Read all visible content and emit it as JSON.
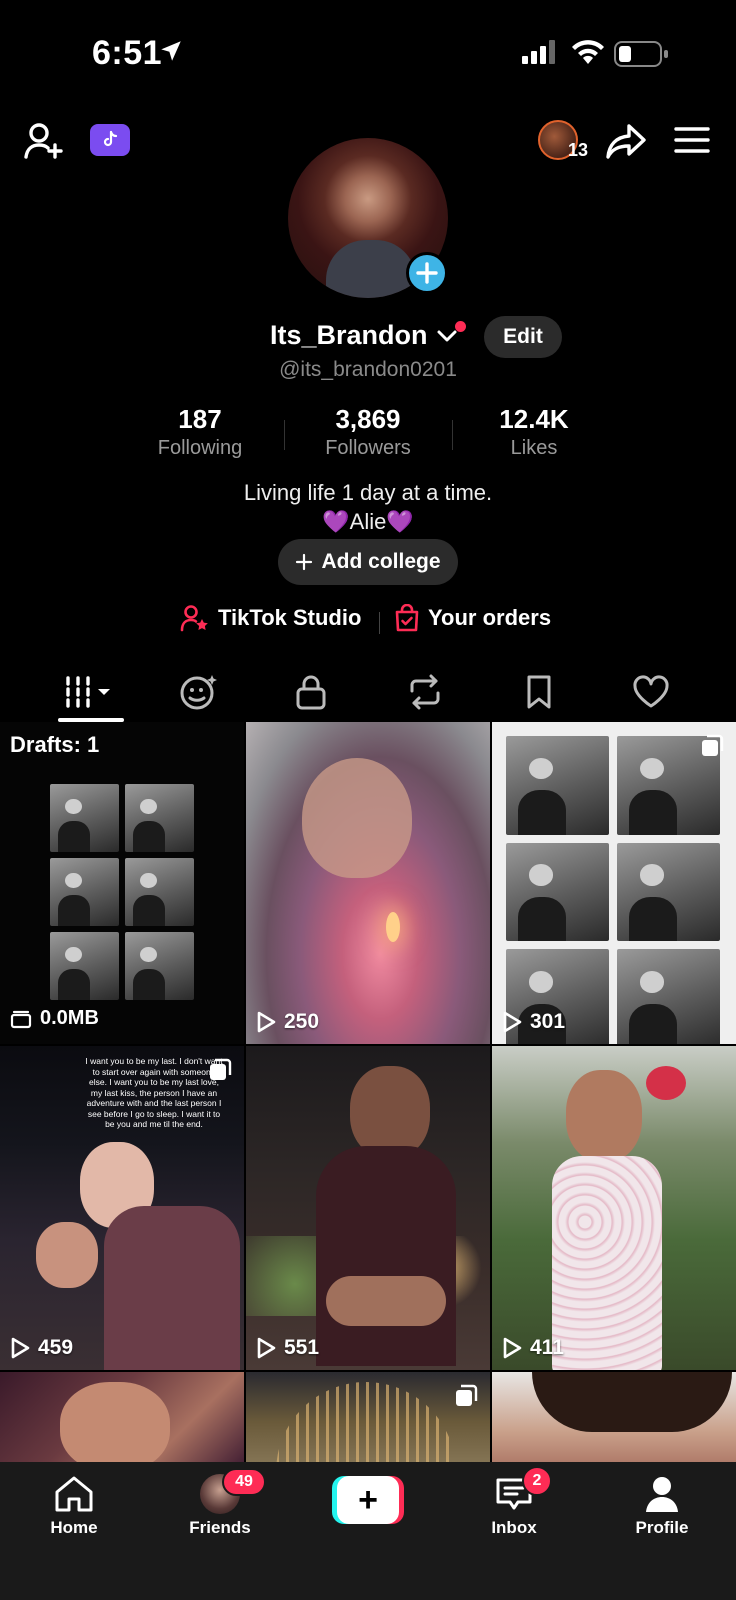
{
  "status_bar": {
    "time": "6:51"
  },
  "top_bar": {
    "story_count": "13"
  },
  "profile": {
    "username": "Its_Brandon",
    "handle": "@its_brandon0201",
    "edit_label": "Edit",
    "stats": [
      {
        "value": "187",
        "label": "Following"
      },
      {
        "value": "3,869",
        "label": "Followers"
      },
      {
        "value": "12.4K",
        "label": "Likes"
      }
    ],
    "bio_line1": "Living life 1 day at a time.",
    "bio_line2": "💜Alie💜",
    "add_college_label": "Add college"
  },
  "links": {
    "studio": "TikTok Studio",
    "orders": "Your orders"
  },
  "tabs": [
    "videos",
    "reposts-emoji",
    "private",
    "repost",
    "favorites",
    "liked"
  ],
  "grid": {
    "drafts_label": "Drafts: 1",
    "drafts_size": "0.0MB",
    "videos": [
      {
        "views": "250"
      },
      {
        "views": "301"
      },
      {
        "views": "459"
      },
      {
        "views": "551"
      },
      {
        "views": "411"
      }
    ],
    "overlay_text": "I want you to be my last. I don't want to start over again with someone else. I want you to be my last love, my last kiss, the person I have an adventure with and the last person I see before I go to sleep. I want it to be you and me til the end."
  },
  "bottom_nav": {
    "home": "Home",
    "friends": "Friends",
    "friends_badge": "49",
    "inbox": "Inbox",
    "inbox_badge": "2",
    "profile": "Profile"
  },
  "colors": {
    "accent_red": "#fe2c55",
    "accent_cyan": "#25f4ee",
    "add_blue": "#3eb4e6",
    "badge_purple": "#7b4cf0"
  }
}
